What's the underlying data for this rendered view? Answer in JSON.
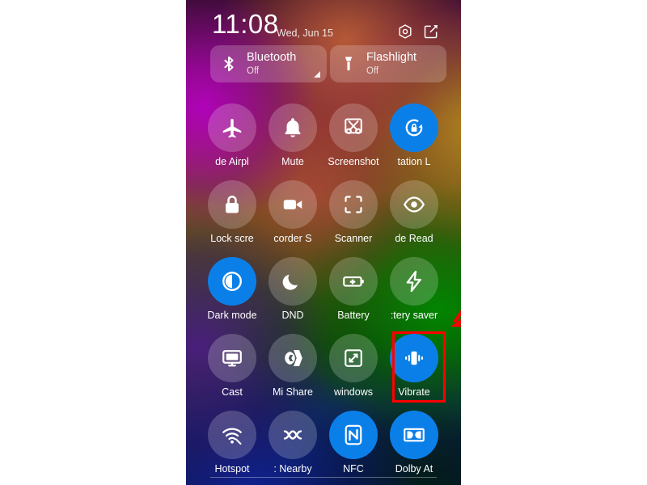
{
  "screen": {
    "status": {
      "time": "11:08",
      "date": "Wed, Jun 15",
      "settings_icon": "hexagon-gear-icon",
      "edit_icon": "edit-square-icon"
    },
    "big_tiles": [
      {
        "name": "bluetooth",
        "title": "Bluetooth",
        "state": "Off",
        "icon": "bluetooth-icon",
        "expandable": true
      },
      {
        "name": "flashlight",
        "title": "Flashlight",
        "state": "Off",
        "icon": "flashlight-icon",
        "expandable": false
      }
    ],
    "grid_rows": [
      {
        "tiles": [
          {
            "name": "airplane-mode",
            "label": "de    Airpl",
            "icon": "airplane-icon",
            "on": false
          },
          {
            "name": "mute",
            "label": "Mute",
            "icon": "bell-icon",
            "on": false
          },
          {
            "name": "screenshot",
            "label": "Screenshot",
            "icon": "scissors-crop-icon",
            "on": false
          },
          {
            "name": "rotation-lock",
            "label": "tation      L",
            "icon": "rotation-lock-icon",
            "on": true
          }
        ]
      },
      {
        "tiles": [
          {
            "name": "lock-screen",
            "label": "Lock scre",
            "icon": "padlock-icon",
            "on": false
          },
          {
            "name": "screen-recorder",
            "label": "corder      S",
            "icon": "video-camera-icon",
            "on": false
          },
          {
            "name": "scanner",
            "label": "Scanner",
            "icon": "scan-frame-icon",
            "on": false
          },
          {
            "name": "reading-mode",
            "label": "de    Read",
            "icon": "eye-icon",
            "on": false
          }
        ]
      },
      {
        "tiles": [
          {
            "name": "dark-mode",
            "label": "Dark mode",
            "icon": "contrast-circle-icon",
            "on": true
          },
          {
            "name": "dnd",
            "label": "DND",
            "icon": "crescent-moon-icon",
            "on": false
          },
          {
            "name": "battery",
            "label": "Battery",
            "icon": "battery-plus-icon",
            "on": false
          },
          {
            "name": "battery-saver",
            "label": ":tery saver",
            "icon": "lightning-bolt-icon",
            "on": false
          }
        ]
      },
      {
        "tiles": [
          {
            "name": "cast",
            "label": "Cast",
            "icon": "cast-monitor-icon",
            "on": false,
            "highlighted": true
          },
          {
            "name": "mi-share",
            "label": "Mi Share",
            "icon": "mi-share-icon",
            "on": false
          },
          {
            "name": "cast-to-windows",
            "label": "windows",
            "icon": "diagonal-arrows-square-icon",
            "on": false
          },
          {
            "name": "vibrate",
            "label": "Vibrate",
            "icon": "vibrate-icon",
            "on": true
          }
        ]
      },
      {
        "tiles": [
          {
            "name": "hotspot",
            "label": "Hotspot",
            "icon": "hotspot-icon",
            "on": false
          },
          {
            "name": "nearby",
            "label": ":      Nearby",
            "icon": "nearby-share-icon",
            "on": false
          },
          {
            "name": "nfc",
            "label": "NFC",
            "icon": "nfc-icon",
            "on": true
          },
          {
            "name": "dolby-atmos",
            "label": "Dolby At",
            "icon": "dolby-icon",
            "on": true
          }
        ]
      }
    ]
  },
  "annotations": {
    "highlight_color": "#ff0000",
    "arrow_color": "#ff0000",
    "highlight_target": "cast",
    "arrow_points_to": "cast"
  }
}
